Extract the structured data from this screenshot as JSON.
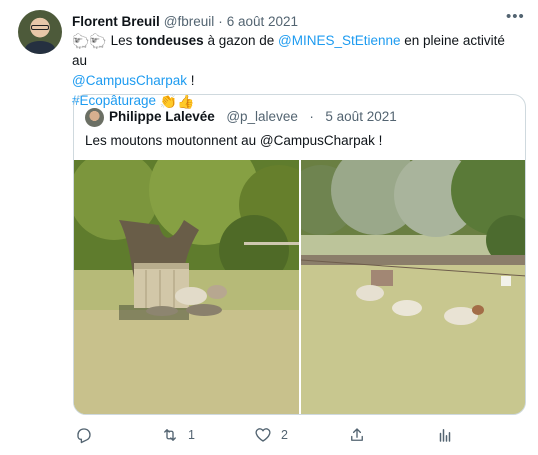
{
  "tweet": {
    "author_name": "Florent Breuil",
    "author_handle": "@fbreuil",
    "separator": "·",
    "date": "6 août 2021",
    "text": {
      "emoji_sheep": "🐑🐑",
      "part1": "Les ",
      "bold": "tondeuses",
      "part2": " à gazon de ",
      "mention1": "@MINES_StEtienne",
      "part3": " en pleine activité au",
      "mention2": "@CampusCharpak",
      "part4": " !",
      "hashtag": "#Ecopâturage",
      "emoji_end": "👏👍"
    }
  },
  "quote": {
    "author_name": "Philippe Lalevée",
    "author_handle": "@p_lalevee",
    "separator": "·",
    "date": "5 août 2021",
    "text": "Les moutons moutonnent au @CampusCharpak !"
  },
  "actions": {
    "reply": {
      "icon": "reply-icon",
      "count": ""
    },
    "retweet": {
      "icon": "retweet-icon",
      "count": "1"
    },
    "like": {
      "icon": "heart-icon",
      "count": "2"
    },
    "share": {
      "icon": "share-icon",
      "count": ""
    },
    "analytics": {
      "icon": "analytics-icon",
      "count": ""
    }
  },
  "colors": {
    "link": "#1d9bf0",
    "muted": "#536471",
    "border": "#cfd9de"
  }
}
